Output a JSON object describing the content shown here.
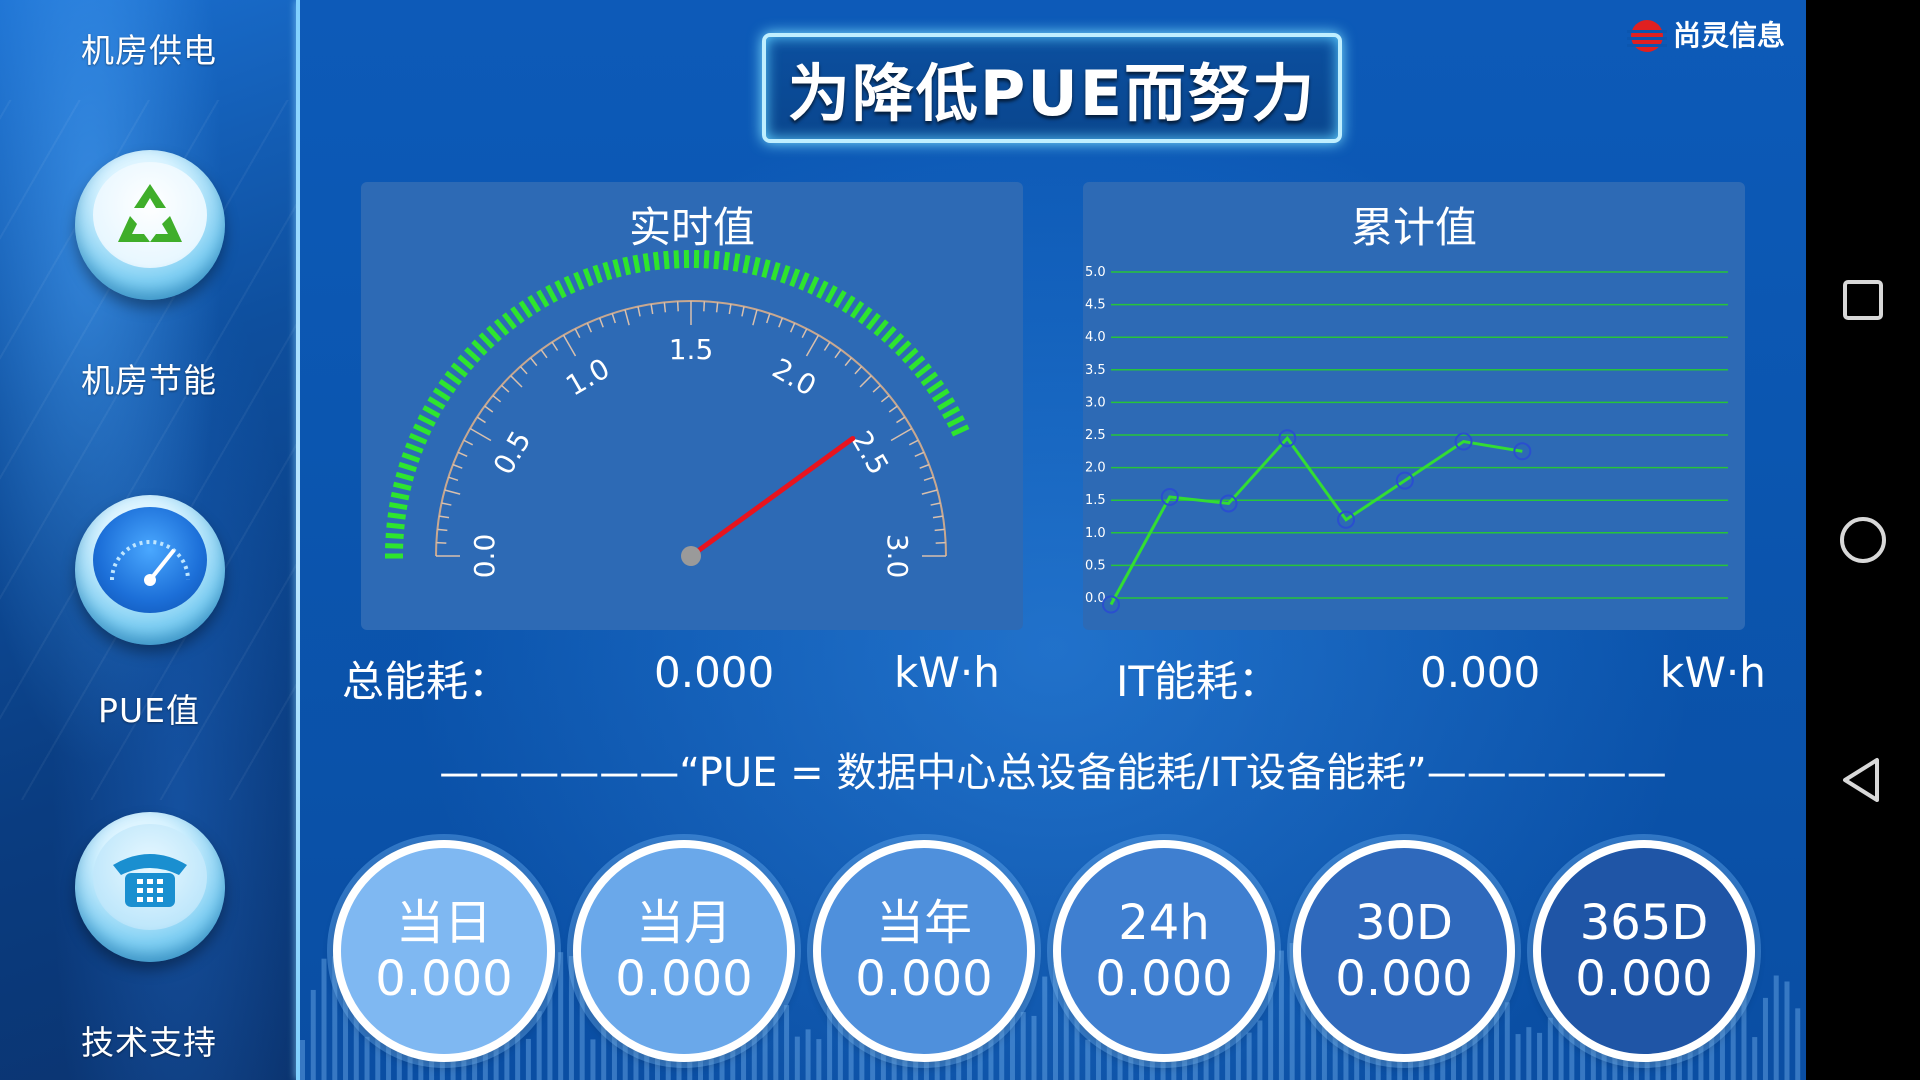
{
  "sidebar": {
    "items": [
      {
        "label": "机房供电",
        "icon": "power-icon"
      },
      {
        "label": "机房节能",
        "icon": "recycle-icon"
      },
      {
        "label": "PUE值",
        "icon": "gauge-icon"
      },
      {
        "label": "技术支持",
        "icon": "telephone-icon"
      }
    ]
  },
  "header": {
    "brand": "尚灵信息",
    "title": "为降低PUE而努力"
  },
  "realtime_panel": {
    "title": "实时值",
    "gauge_ticks": [
      "0.0",
      "0.5",
      "1.0",
      "1.5",
      "2.0",
      "2.5",
      "3.0"
    ],
    "gauge_min": 0,
    "gauge_max": 3,
    "needle_value": 2.4,
    "needle_color": "#e8141e",
    "arc_color": "#2ee52e"
  },
  "cumulative_panel": {
    "title": "累计值"
  },
  "chart_data": {
    "type": "line",
    "title": "累计值",
    "y_ticks": [
      "0.0",
      "0.5",
      "1.0",
      "1.5",
      "2.0",
      "2.5",
      "3.0",
      "3.5",
      "4.0",
      "4.5",
      "5.0"
    ],
    "ylim": [
      0,
      5
    ],
    "x": [
      0,
      1,
      2,
      3,
      4,
      5,
      6,
      7
    ],
    "values": [
      -0.1,
      1.55,
      1.45,
      2.45,
      1.2,
      1.8,
      2.4,
      2.25
    ],
    "line_color": "#33dd33",
    "marker_color": "#2a4fcf",
    "grid": true
  },
  "stats": {
    "total_label": "总能耗：",
    "total_value": "0.000",
    "total_unit": "kW·h",
    "it_label": "IT能耗：",
    "it_value": "0.000",
    "it_unit": "kW·h"
  },
  "formula": "——————“PUE = 数据中心总设备能耗/IT设备能耗”——————",
  "periods": [
    {
      "label": "当日",
      "value": "0.000",
      "color": "#7fb8f2"
    },
    {
      "label": "当月",
      "value": "0.000",
      "color": "#6aa8ea"
    },
    {
      "label": "当年",
      "value": "0.000",
      "color": "#4f90dc"
    },
    {
      "label": "24h",
      "value": "0.000",
      "color": "#3f7fd0"
    },
    {
      "label": "30D",
      "value": "0.000",
      "color": "#2f69bc"
    },
    {
      "label": "365D",
      "value": "0.000",
      "color": "#1f55a6"
    }
  ]
}
